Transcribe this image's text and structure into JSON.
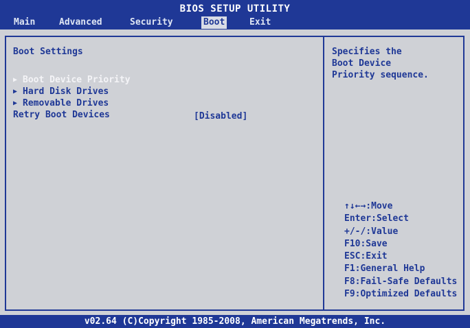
{
  "header": {
    "title": "BIOS SETUP UTILITY",
    "tabs": [
      {
        "label": "Main",
        "active": false
      },
      {
        "label": "Advanced",
        "active": false
      },
      {
        "label": "Security",
        "active": false
      },
      {
        "label": "Boot",
        "active": true
      },
      {
        "label": "Exit",
        "active": false
      }
    ]
  },
  "main": {
    "section_title": "Boot Settings",
    "items": [
      {
        "label": "Boot Device Priority",
        "selected": true
      },
      {
        "label": "Hard Disk Drives",
        "selected": false
      },
      {
        "label": "Removable Drives",
        "selected": false
      }
    ],
    "option": {
      "label": "Retry Boot Devices",
      "value": "[Disabled]"
    }
  },
  "help": {
    "lines": [
      "Specifies the",
      "Boot Device",
      "Priority sequence."
    ]
  },
  "keys": [
    "↑↓←→:Move",
    "Enter:Select",
    "+/-/:Value",
    "F10:Save",
    "ESC:Exit",
    "F1:General Help",
    "F8:Fail-Safe Defaults",
    "F9:Optimized Defaults"
  ],
  "footer": "v02.64 (C)Copyright 1985-2008, American Megatrends, Inc.",
  "colors": {
    "bar_blue": "#1f3896",
    "panel_gray": "#cfd1d6",
    "highlight_text": "#f4f4f7"
  },
  "icons": {
    "submenu": "triangle-right-icon"
  }
}
